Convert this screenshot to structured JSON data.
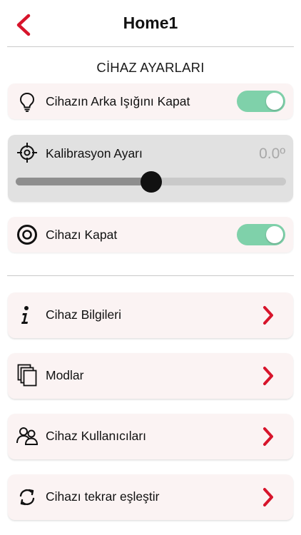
{
  "header": {
    "title": "Home1",
    "back_icon": "chevron-left-icon"
  },
  "section_title": "CİHAZ AYARLARI",
  "settings": {
    "backlight": {
      "label": "Cihazın Arka Işığını Kapat",
      "icon": "lightbulb-icon",
      "enabled": true
    },
    "calibration": {
      "label": "Kalibrasyon Ayarı",
      "icon": "crosshair-icon",
      "value": "0.0º",
      "slider_fraction": 0.5
    },
    "power": {
      "label": "Cihazı Kapat",
      "icon": "power-ring-icon",
      "enabled": true
    }
  },
  "menu": [
    {
      "label": "Cihaz Bilgileri",
      "icon": "info-icon"
    },
    {
      "label": "Modlar",
      "icon": "copy-pages-icon"
    },
    {
      "label": "Cihaz Kullanıcıları",
      "icon": "users-icon"
    },
    {
      "label": "Cihazı tekrar eşleştir",
      "icon": "sync-icon"
    }
  ],
  "colors": {
    "accent_red": "#d7142b",
    "toggle_on": "#7fd1aa",
    "card_bg": "#fbf3f3",
    "calibration_bg": "#e1e1e1"
  }
}
